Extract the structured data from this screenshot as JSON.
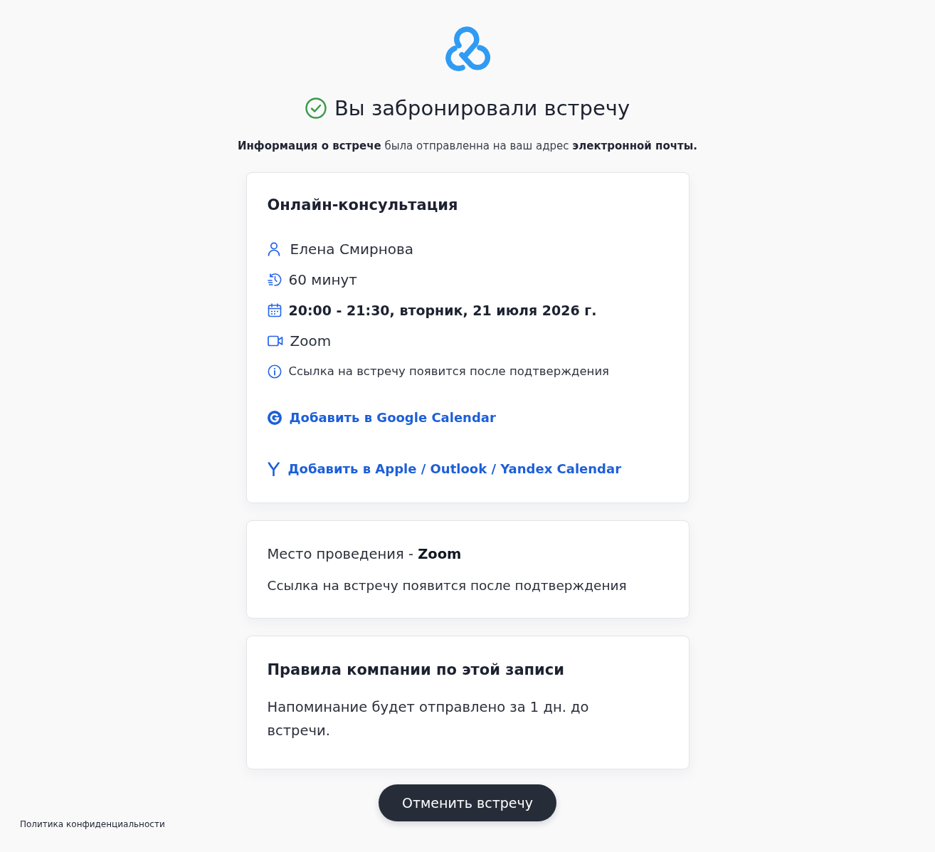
{
  "heading": {
    "title": "Вы забронировали встречу"
  },
  "notice": "**Информация о встрече** была отправленна на ваш адрес **электронной почты.**",
  "booking_card": {
    "title": "Онлайн-консультация",
    "details": [
      {
        "kind": "person",
        "text": "Елена Смирнова"
      },
      {
        "kind": "duration",
        "text": "60 минут"
      },
      {
        "kind": "datetime",
        "text": "20:00 - 21:30, вторник, 21 июля 2026 г."
      },
      {
        "kind": "video",
        "text": "Zoom"
      },
      {
        "kind": "info",
        "text": "Ссылка на встречу появится после подтверждения"
      }
    ],
    "calendar_links": [
      {
        "kind": "google",
        "label": "Добавить в Google Calendar"
      },
      {
        "kind": "yandex",
        "label": "Добавить в Apple / Outlook / Yandex Calendar"
      }
    ]
  },
  "location_card": {
    "place": "Место проведения - **Zoom**",
    "note": "Ссылка на встречу появится после подтверждения"
  },
  "rules_card": {
    "title": "Правила компании по этой записи",
    "text": "Напоминание будет отправлено за 1 дн. до встречи."
  },
  "cancel_button": {
    "label": "Отменить встречу"
  },
  "footer": {
    "privacy_link": "Политика конфиденциальности"
  }
}
